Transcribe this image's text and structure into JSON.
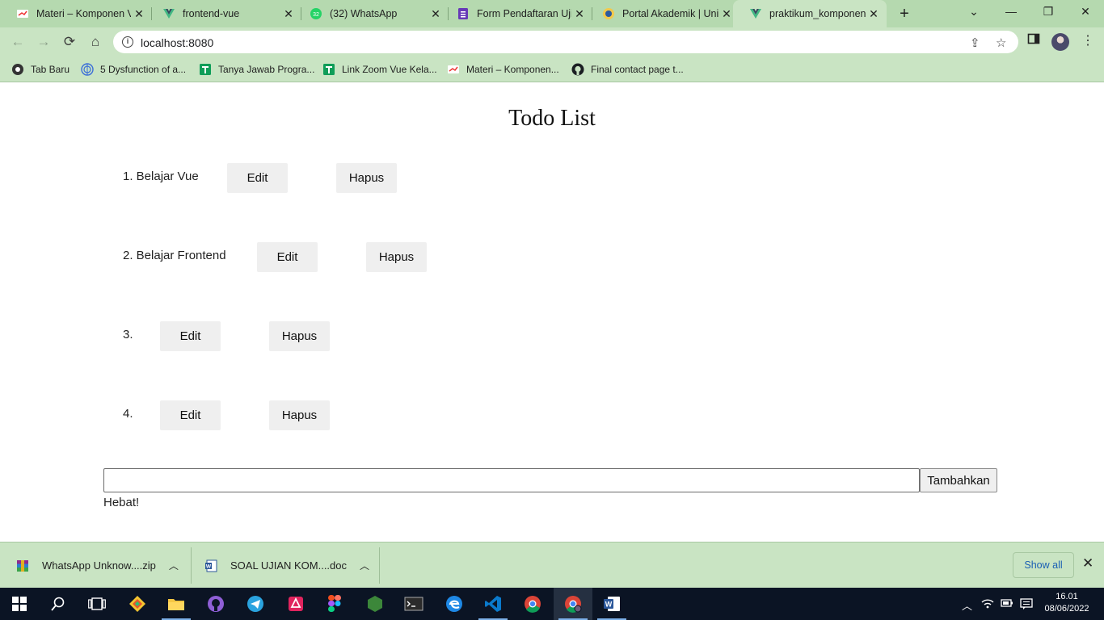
{
  "browser": {
    "tabs": [
      {
        "title": "Materi – Komponen V",
        "icon": "materi-favicon"
      },
      {
        "title": "frontend-vue",
        "icon": "vue-favicon"
      },
      {
        "title": "(32) WhatsApp",
        "icon": "whatsapp-favicon"
      },
      {
        "title": "Form Pendaftaran Ujia",
        "icon": "forms-favicon"
      },
      {
        "title": "Portal Akademik | Univ",
        "icon": "portal-favicon"
      },
      {
        "title": "praktikum_komponen",
        "icon": "vue-favicon",
        "active": true
      }
    ],
    "new_tab_symbol": "+",
    "url": "localhost:8080",
    "bookmarks": [
      {
        "label": "Tab Baru",
        "icon": "chrome-icon"
      },
      {
        "label": "5 Dysfunction of a...",
        "icon": "globe-icon"
      },
      {
        "label": "Tanya Jawab Progra...",
        "icon": "sheets-icon"
      },
      {
        "label": "Link Zoom Vue Kela...",
        "icon": "sheets-icon"
      },
      {
        "label": "Materi – Komponen...",
        "icon": "materi-icon"
      },
      {
        "label": "Final contact page t...",
        "icon": "github-icon"
      }
    ]
  },
  "app": {
    "title": "Todo List",
    "todos": [
      {
        "label": "1. Belajar Vue"
      },
      {
        "label": "2. Belajar Frontend"
      },
      {
        "label": "3."
      },
      {
        "label": "4."
      }
    ],
    "edit_label": "Edit",
    "delete_label": "Hapus",
    "new_todo_value": "",
    "add_label": "Tambahkan",
    "status_text": "Hebat!"
  },
  "downloads": {
    "items": [
      {
        "name": "WhatsApp Unknow....zip",
        "icon": "winrar-icon"
      },
      {
        "name": "SOAL UJIAN KOM....doc",
        "icon": "word-doc-icon"
      }
    ],
    "show_all_label": "Show all"
  },
  "taskbar": {
    "apps": [
      "git-kraken-icon",
      "file-explorer-icon",
      "github-desktop-icon",
      "telegram-icon",
      "postman-icon",
      "figma-icon",
      "nodejs-icon",
      "terminal-icon",
      "edge-icon",
      "vscode-icon",
      "chrome-icon",
      "chrome-profile-icon",
      "word-icon"
    ],
    "time": "16.01",
    "date": "08/06/2022"
  },
  "colors": {
    "chrome_frame": "#b5d9af",
    "chrome_toolbar": "#c9e4c3",
    "button_bg": "#efefef",
    "taskbar_bg": "#0b1424"
  }
}
